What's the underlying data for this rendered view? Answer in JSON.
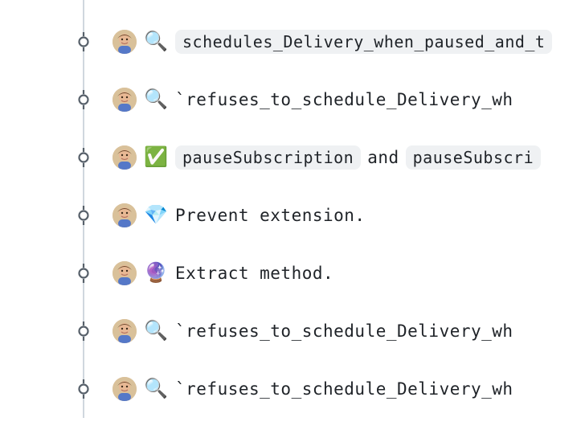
{
  "commits": [
    {
      "emoji": "🔍",
      "type": "pill",
      "pill_text": "schedules_Delivery_when_paused_and_t"
    },
    {
      "emoji": "🔍",
      "type": "plain",
      "text": "`refuses_to_schedule_Delivery_wh"
    },
    {
      "emoji": "✅",
      "type": "double_pill",
      "pill1": "pauseSubscription",
      "joiner": "and",
      "pill2": "pauseSubscri"
    },
    {
      "emoji": "💎",
      "type": "text",
      "text": "Prevent extension."
    },
    {
      "emoji": "🔮",
      "type": "text",
      "text": "Extract method."
    },
    {
      "emoji": "🔍",
      "type": "plain",
      "text": "`refuses_to_schedule_Delivery_wh"
    },
    {
      "emoji": "🔍",
      "type": "plain",
      "text": "`refuses_to_schedule_Delivery_wh"
    }
  ]
}
